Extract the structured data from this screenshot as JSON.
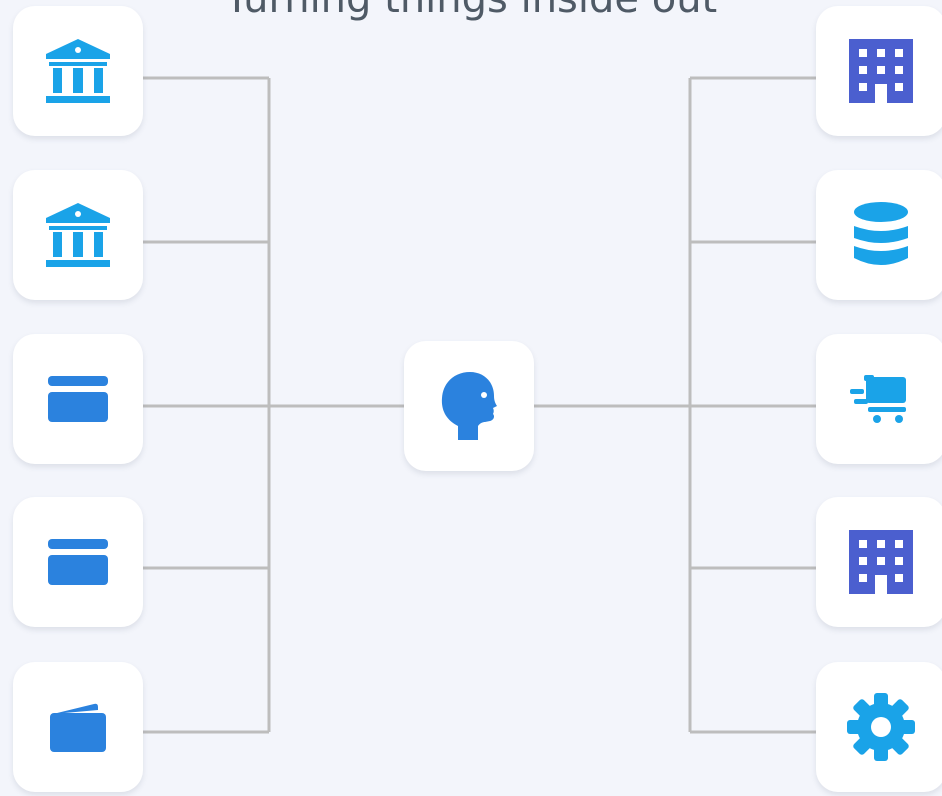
{
  "title": "Turning things inside out",
  "colors": {
    "background": "#f3f5fb",
    "card": "#ffffff",
    "connector": "#bdbdbd",
    "icon_light_blue": "#1aa3e8",
    "icon_blue": "#2b82de",
    "icon_indigo": "#4b5fcf"
  },
  "center_node": {
    "icon": "person-head-icon"
  },
  "left_nodes": [
    {
      "icon": "bank-icon"
    },
    {
      "icon": "bank-icon"
    },
    {
      "icon": "credit-card-icon"
    },
    {
      "icon": "credit-card-icon"
    },
    {
      "icon": "wallet-icon"
    }
  ],
  "right_nodes": [
    {
      "icon": "office-building-icon"
    },
    {
      "icon": "database-icon"
    },
    {
      "icon": "fast-cart-icon"
    },
    {
      "icon": "office-building-icon"
    },
    {
      "icon": "gear-icon"
    }
  ]
}
